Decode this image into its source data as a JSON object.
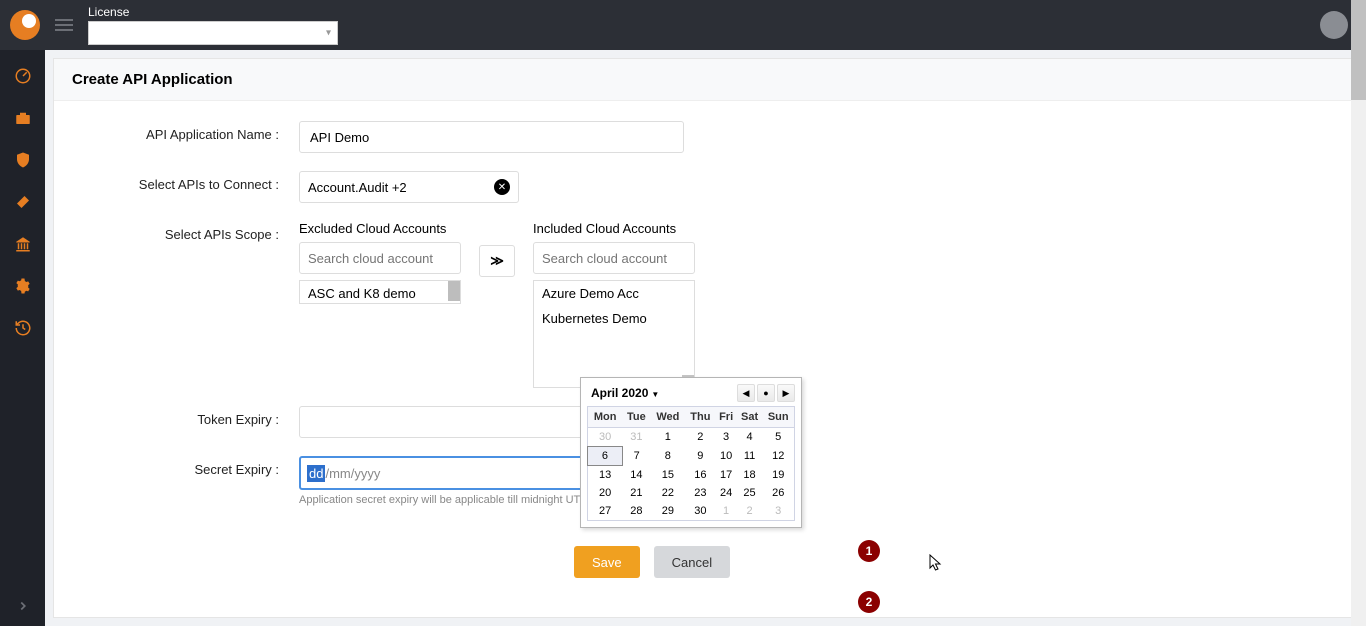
{
  "header": {
    "license_label": "License",
    "license_value": ""
  },
  "sidebar": {
    "items": [
      "dashboard",
      "toolbox",
      "shield",
      "tool",
      "institution",
      "settings",
      "history"
    ]
  },
  "panel": {
    "title": "Create API Application"
  },
  "form": {
    "app_name_label": "API Application Name :",
    "app_name_value": "API Demo",
    "apis_connect_label": "Select APIs to Connect :",
    "apis_connect_value": "Account.Audit +2",
    "apis_scope_label": "Select APIs Scope :",
    "excluded_title": "Excluded Cloud Accounts",
    "included_title": "Included Cloud Accounts",
    "search_placeholder": "Search cloud account",
    "excluded_items": [
      "ASC and K8 demo"
    ],
    "included_items": [
      "Azure Demo Acc",
      "Kubernetes Demo"
    ],
    "move_label": "≫",
    "token_expiry_label": "Token Expiry :",
    "secret_expiry_label": "Secret Expiry :",
    "secret_value_highlight": "dd",
    "secret_value_rest": "/mm/yyyy",
    "secret_helper": "Application secret expiry will be applicable till midnight UTC of selected date."
  },
  "datepicker": {
    "month_label": "April 2020",
    "days": [
      "Mon",
      "Tue",
      "Wed",
      "Thu",
      "Fri",
      "Sat",
      "Sun"
    ],
    "rows": [
      [
        {
          "d": "30",
          "o": true
        },
        {
          "d": "31",
          "o": true
        },
        {
          "d": "1"
        },
        {
          "d": "2"
        },
        {
          "d": "3"
        },
        {
          "d": "4"
        },
        {
          "d": "5"
        }
      ],
      [
        {
          "d": "6",
          "sel": true
        },
        {
          "d": "7"
        },
        {
          "d": "8"
        },
        {
          "d": "9"
        },
        {
          "d": "10"
        },
        {
          "d": "11"
        },
        {
          "d": "12"
        }
      ],
      [
        {
          "d": "13"
        },
        {
          "d": "14"
        },
        {
          "d": "15"
        },
        {
          "d": "16"
        },
        {
          "d": "17"
        },
        {
          "d": "18"
        },
        {
          "d": "19"
        }
      ],
      [
        {
          "d": "20"
        },
        {
          "d": "21"
        },
        {
          "d": "22"
        },
        {
          "d": "23"
        },
        {
          "d": "24"
        },
        {
          "d": "25"
        },
        {
          "d": "26"
        }
      ],
      [
        {
          "d": "27"
        },
        {
          "d": "28"
        },
        {
          "d": "29"
        },
        {
          "d": "30"
        },
        {
          "d": "1",
          "o": true
        },
        {
          "d": "2",
          "o": true
        },
        {
          "d": "3",
          "o": true
        }
      ]
    ]
  },
  "buttons": {
    "save": "Save",
    "cancel": "Cancel"
  },
  "annotations": {
    "a1": "1",
    "a2": "2"
  }
}
